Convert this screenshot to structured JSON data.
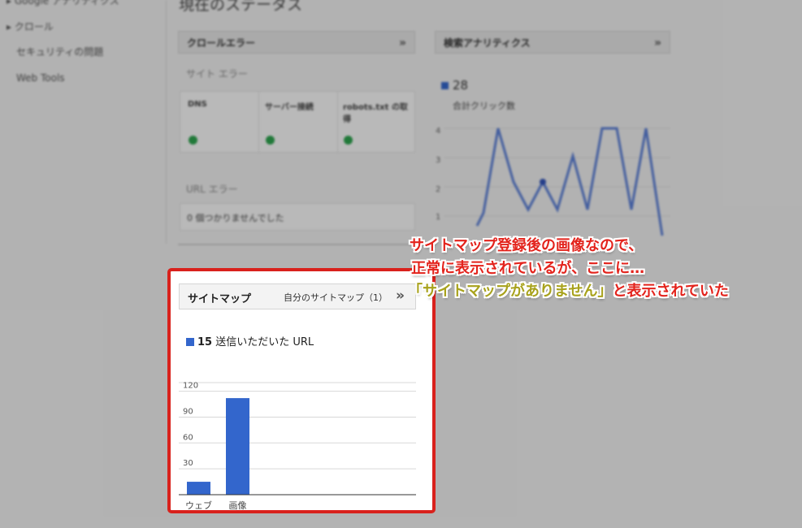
{
  "sidebar": {
    "items": [
      "Google アナリティクス",
      "クロール",
      "セキュリティの問題",
      "Web Tools"
    ]
  },
  "background": {
    "page_title": "現在のステータス",
    "crawl_errors": {
      "title": "クロールエラー",
      "site_errors": "サイト エラー",
      "columns": [
        "DNS",
        "サーバー接続",
        "robots.txt の取得"
      ],
      "url_errors": "URL エラー",
      "url_errors_value": "0 個つかりませんでした"
    },
    "search_analytics": {
      "title": "検索アナリティクス",
      "legend_value": "28",
      "legend_label": "合計クリック数",
      "y_ticks": [
        "4",
        "3",
        "2",
        "1"
      ]
    }
  },
  "sitemap_card": {
    "title": "サイトマップ",
    "link": "自分のサイトマップ（1）",
    "chevron": "»",
    "legend_value": "15",
    "legend_label": "送信いただいた URL"
  },
  "chart_data": {
    "type": "bar",
    "categories": [
      "ウェブ",
      "画像"
    ],
    "series": [
      {
        "name": "送信いただいた URL",
        "values": [
          15,
          112
        ]
      }
    ],
    "y_ticks": [
      120,
      90,
      60,
      30
    ],
    "ylim": [
      0,
      130
    ],
    "bar_color": "#3366cc",
    "grid": true
  },
  "annotation": {
    "line1": "サイトマップ登録後の画像なので、",
    "line2": "正常に表示されているが、ここに…",
    "line3_quote": "「サイトマップがありません」",
    "line3_rest": "と表示されていた",
    "colors": {
      "red": "#e3231c",
      "olive": "#a8a21c"
    }
  },
  "colors": {
    "highlight_border": "#d9211c",
    "accent_blue": "#3366cc",
    "status_green": "#2da44e"
  }
}
